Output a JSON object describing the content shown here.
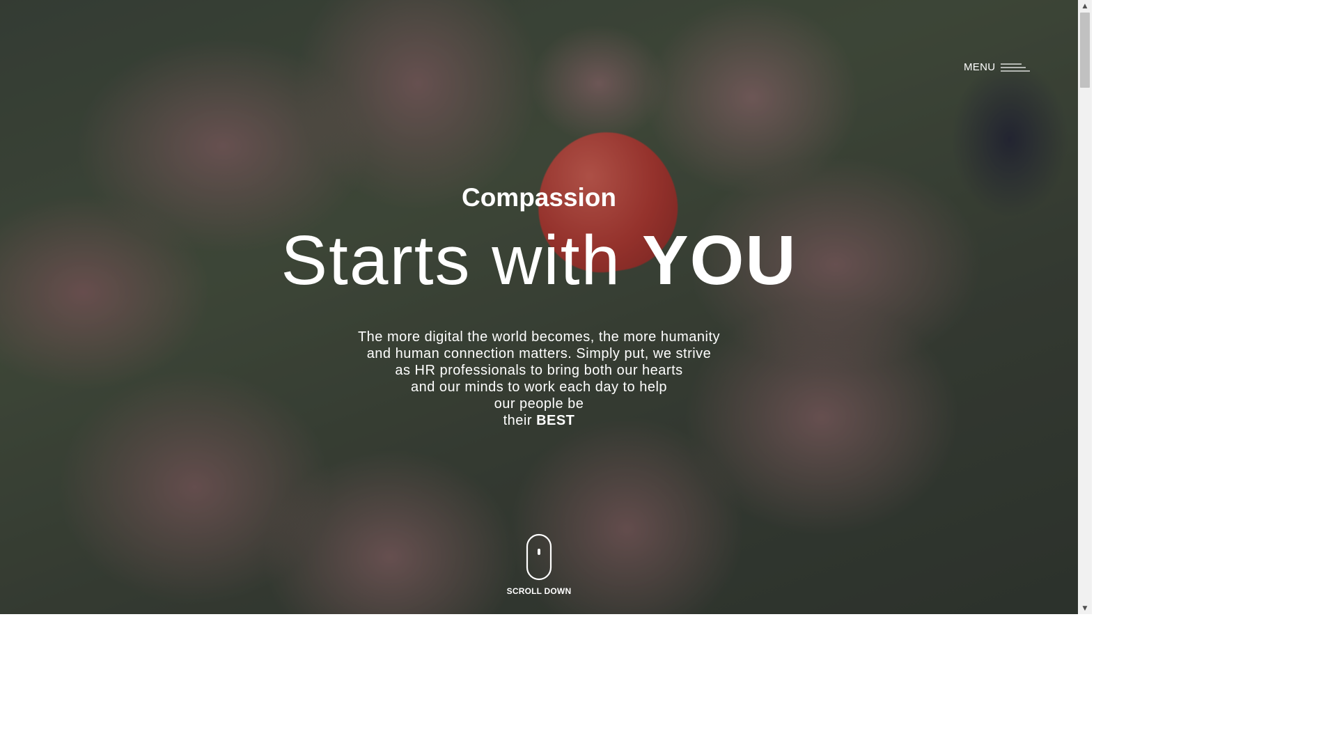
{
  "menu": {
    "label": "MENU",
    "icon": "hamburger-menu-icon"
  },
  "hero": {
    "subtitle": "Compassion",
    "headline_light": "Starts with",
    "headline_strong": "YOU",
    "body_lines": [
      "The more digital the world becomes, the more humanity",
      "and human connection matters. Simply put, we strive",
      "as HR professionals to bring both our hearts",
      "and our minds to work each day to help",
      "our people be"
    ],
    "body_last_prefix": "their",
    "body_last_strong": "BEST"
  },
  "scroll_down": {
    "label": "SCROLL DOWN",
    "icon": "mouse-scroll-icon"
  },
  "scrollbar": {
    "up_arrow": "▲",
    "down_arrow": "▼"
  },
  "colors": {
    "text": "#ffffff",
    "overlay": "#28263061",
    "heart": "#d73a2a"
  }
}
